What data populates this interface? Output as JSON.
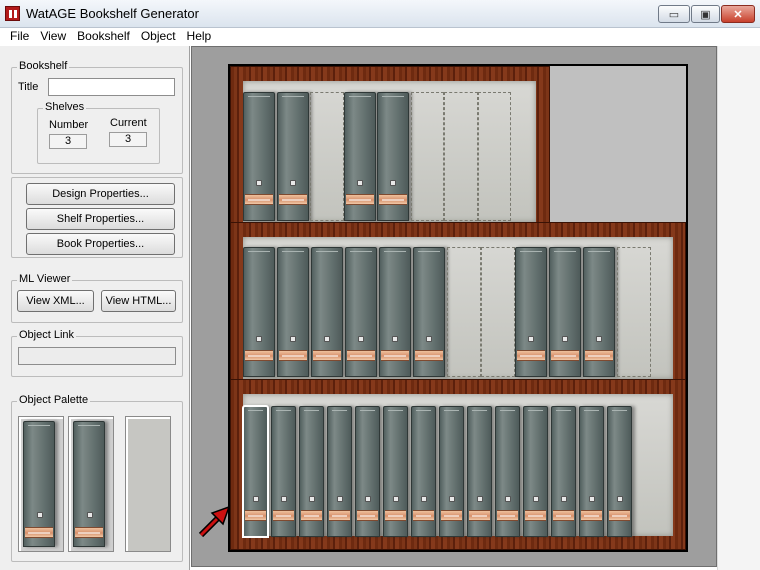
{
  "window": {
    "title": "WatAGE Bookshelf Generator",
    "controls": {
      "minimize": "▭",
      "maximize": "▣",
      "close": "✕"
    }
  },
  "menu": [
    "File",
    "View",
    "Bookshelf",
    "Object",
    "Help"
  ],
  "bookshelf_group": {
    "label": "Bookshelf",
    "title_label": "Title",
    "title_value": "",
    "shelves": {
      "label": "Shelves",
      "number_label": "Number",
      "number_value": "3",
      "current_label": "Current",
      "current_value": "3"
    }
  },
  "properties_buttons": [
    "Design Properties...",
    "Shelf Properties...",
    "Book Properties..."
  ],
  "ml_viewer": {
    "label": "ML Viewer",
    "view_xml": "View XML...",
    "view_html": "View HTML..."
  },
  "object_link": {
    "label": "Object Link",
    "value": ""
  },
  "object_palette": {
    "label": "Object Palette",
    "items": [
      "book-binder",
      "book-binder",
      "empty-slot"
    ]
  },
  "bookshelf_canvas": {
    "shelves": [
      {
        "slots": [
          "book",
          "book",
          "empty",
          "book",
          "book",
          "empty",
          "empty",
          "empty"
        ]
      },
      {
        "slots": [
          "book",
          "book",
          "book",
          "book",
          "book",
          "book",
          "empty",
          "empty",
          "book",
          "book",
          "book",
          "empty"
        ]
      },
      {
        "slots": [
          "book-selected",
          "book",
          "book",
          "book",
          "book",
          "book",
          "book",
          "book",
          "book",
          "book",
          "book",
          "book",
          "book",
          "book"
        ]
      }
    ]
  },
  "colors": {
    "wood": "#6e2a10",
    "book_spine": "#5e6b6a",
    "label_band": "#d7906b",
    "canvas_bg": "#9e9e9e",
    "selection_arrow": "#cc1111"
  }
}
